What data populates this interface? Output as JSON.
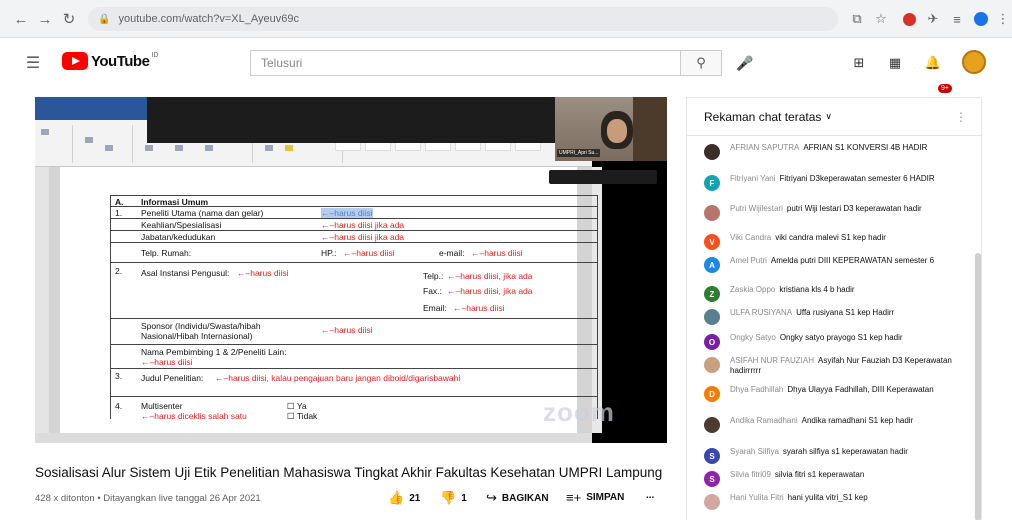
{
  "browser": {
    "url": "youtube.com/watch?v=XL_Ayeuv69c"
  },
  "youtube": {
    "logo_text": "YouTube",
    "logo_sup": "ID",
    "search_placeholder": "Telusuri",
    "notif_count": "9+"
  },
  "document": {
    "rows": [
      {
        "num": "A.",
        "label": "Informasi Umum",
        "hint": "",
        "col2": "",
        "col2hint": ""
      },
      {
        "num": "1.",
        "label": "Peneliti Utama (nama dan gelar)",
        "hint": "←–harus diisi",
        "col2": "",
        "col2hint": ""
      },
      {
        "num": "",
        "label": "Keahlian/Spesialisasi",
        "hint": "←–harus diisi jika ada",
        "col2": "",
        "col2hint": ""
      },
      {
        "num": "",
        "label": "Jabatan/kedudukan",
        "hint": "←–harus diisi jika ada",
        "col2": "",
        "col2hint": ""
      },
      {
        "num": "",
        "label": "Telp. Rumah:",
        "hint": "",
        "col2": "HP.:",
        "col2hint": "←–harus diisi"
      },
      {
        "num": "2.",
        "label": "Asal Instansi Pengusul:",
        "hint": "←–harus diisi",
        "col2": "",
        "col2hint": ""
      },
      {
        "num": "",
        "label": "Sponsor (Individu/Swasta/hibah Nasional/Hibah Internasional)",
        "hint": "←–harus diisi",
        "col2": "",
        "col2hint": ""
      },
      {
        "num": "",
        "label": "Nama Pembimbing 1 & 2/Peneliti Lain:",
        "hint": "←–harus diisi",
        "col2": "",
        "col2hint": ""
      },
      {
        "num": "3.",
        "label": "Judul Penelitian:",
        "hint": "←–harus diisi, kalau pengajuan baru jangan diboid/digarisbawahi",
        "col2": "",
        "col2hint": ""
      },
      {
        "num": "4.",
        "label": "Multisenter",
        "hint": "←–harus diceklis salah satu",
        "col2": "Ya",
        "col2hint": "Tidak"
      }
    ],
    "email_label": "e-mail:",
    "email_hint": "←–harus diisi",
    "telp_label": "Telp.:",
    "telp_hint": "←–harus diisi, jika ada",
    "fax_label": "Fax.:",
    "fax_hint": "←–harus diisi, jika ada",
    "email2_label": "Email:",
    "email2_hint": "←–harus diisi"
  },
  "camera": {
    "label": "UMPRI_Apri Su..."
  },
  "watermark": "zoom",
  "video": {
    "title": "Sosialisasi Alur Sistem Uji Etik Penelitian Mahasiswa Tingkat Akhir Fakultas Kesehatan UMPRI Lampung",
    "meta": "428 x ditonton • Ditayangkan live tanggal 26 Apr 2021",
    "likes": "21",
    "dislikes": "1",
    "share_label": "BAGIKAN",
    "save_label": "SIMPAN",
    "more_label": "..."
  },
  "chat": {
    "header": "Rekaman chat teratas",
    "messages": [
      {
        "author": "AFRIAN SAPUTRA",
        "text": "AFRIAN S1 KONVERSI 4B HADIR",
        "avatar": "",
        "color": "#3b2f29"
      },
      {
        "author": "Fitriyani Yani",
        "text": "Fitriyani D3keperawatan semester 6 HADIR",
        "avatar": "F",
        "color": "#12a4b5"
      },
      {
        "author": "Putri Wijilestari",
        "text": "putri Wiji lestari D3 keperawatan hadir",
        "avatar": "",
        "color": "#b8756a"
      },
      {
        "author": "Viki Candra",
        "text": "viki candra malevi S1 kep hadir",
        "avatar": "V",
        "color": "#f4511e"
      },
      {
        "author": "Amel Putri",
        "text": "Amelda putri DIII KEPERAWATAN semester 6",
        "avatar": "A",
        "color": "#1e88e5"
      },
      {
        "author": "Zaskia Oppo",
        "text": "kristiana kls 4 b hadir",
        "avatar": "Z",
        "color": "#2e7d32"
      },
      {
        "author": "ULFA RUSIYANA",
        "text": "Uffa rusiyana S1 kep Hadirr",
        "avatar": "",
        "color": "#5a7f8f"
      },
      {
        "author": "Ongky Satyo",
        "text": "Ongky satyo prayogo S1 kep hadir",
        "avatar": "O",
        "color": "#7b1fa2"
      },
      {
        "author": "ASIFAH NUR FAUZIAH",
        "text": "Asyifah Nur Fauziah D3 Keperawatan hadirrrrrr",
        "avatar": "",
        "color": "#c9a07f"
      },
      {
        "author": "Dhya Fadhillah",
        "text": "Dhya Ulayya Fadhillah, DIII Keperawatan",
        "avatar": "D",
        "color": "#f57c00"
      },
      {
        "author": "Andika Ramadhani",
        "text": "Andika ramadhani S1 kep hadir",
        "avatar": "",
        "color": "#4e3b30"
      },
      {
        "author": "Syarah Silfiya",
        "text": "syarah silfiya s1 keperawatan hadir",
        "avatar": "S",
        "color": "#3949ab"
      },
      {
        "author": "Silvia fitri09",
        "text": "silvia fitri s1 keperawatan",
        "avatar": "S",
        "color": "#8e24aa"
      },
      {
        "author": "Hani Yulita Fitri",
        "text": "hani yulita vitri_S1 kep",
        "avatar": "",
        "color": "#d4a6a0"
      }
    ]
  }
}
